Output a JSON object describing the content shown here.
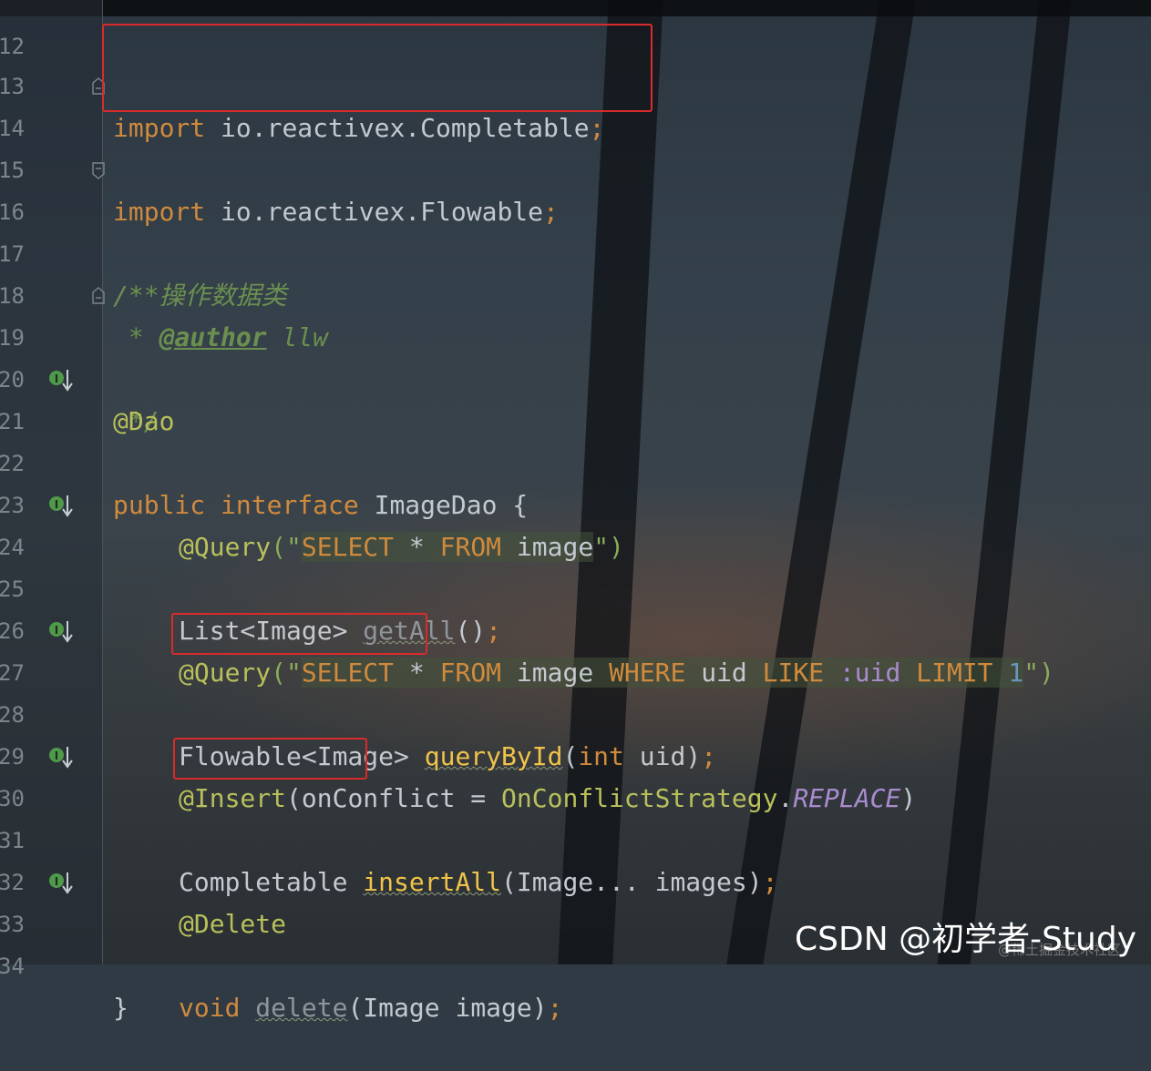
{
  "editor": {
    "lines": [
      {
        "num": "12"
      },
      {
        "num": "13",
        "tokens": [
          "import",
          " io.reactivex.Completable",
          ";"
        ]
      },
      {
        "num": "14",
        "tokens": [
          "import",
          " io.reactivex.Flowable",
          ";"
        ]
      },
      {
        "num": "15"
      },
      {
        "num": "16",
        "tokens": [
          "/**"
        ]
      },
      {
        "num": "17",
        "tokens": [
          " * ",
          "操作数据类"
        ]
      },
      {
        "num": "18",
        "tokens": [
          " * ",
          "@author",
          " llw"
        ]
      },
      {
        "num": "19",
        "tokens": [
          " */"
        ]
      },
      {
        "num": "20",
        "tokens": [
          "@Dao"
        ]
      },
      {
        "num": "21",
        "tokens": [
          "public",
          " ",
          "interface",
          " ImageDao {"
        ]
      },
      {
        "num": "22"
      },
      {
        "num": "23",
        "tokens": [
          "@Query",
          "(\"",
          "SELECT",
          " * ",
          "FROM",
          " image",
          "\")"
        ]
      },
      {
        "num": "24",
        "tokens": [
          "List<Image> ",
          "getAll",
          "()",
          ";"
        ]
      },
      {
        "num": "25"
      },
      {
        "num": "26",
        "tokens": [
          "@Query",
          "(\"",
          "SELECT",
          " * ",
          "FROM",
          " image ",
          "WHERE",
          " uid ",
          "LIKE",
          " :uid ",
          "LIMIT",
          " 1",
          "\")"
        ]
      },
      {
        "num": "27",
        "tokens": [
          "Flowable<Image>",
          " ",
          "queryById",
          "(",
          "int",
          " uid)",
          ";"
        ]
      },
      {
        "num": "28"
      },
      {
        "num": "29",
        "tokens": [
          "@Insert",
          "(onConflict = ",
          "OnConflictStrategy",
          ".",
          "REPLACE",
          ")"
        ]
      },
      {
        "num": "30",
        "tokens": [
          "Completable",
          " ",
          "insertAll",
          "(Image... images)",
          ";"
        ]
      },
      {
        "num": "31"
      },
      {
        "num": "32",
        "tokens": [
          "@Delete"
        ]
      },
      {
        "num": "33",
        "tokens": [
          "void",
          " ",
          "delete",
          "(Image image)",
          ";"
        ]
      },
      {
        "num": "34",
        "tokens": [
          "}"
        ]
      }
    ]
  },
  "watermark": {
    "main": "CSDN @初学者-Study",
    "sub": "@稀土掘金技术社区"
  },
  "colors": {
    "keyword": "#d08a3d",
    "annotation": "#b9c05b",
    "method": "#f0c34a",
    "comment": "#6b8f4f",
    "highlight_box": "#d92b2b"
  },
  "icons": {
    "implementation_marker": "implemented-by-icon",
    "fold_marker": "fold-icon"
  }
}
